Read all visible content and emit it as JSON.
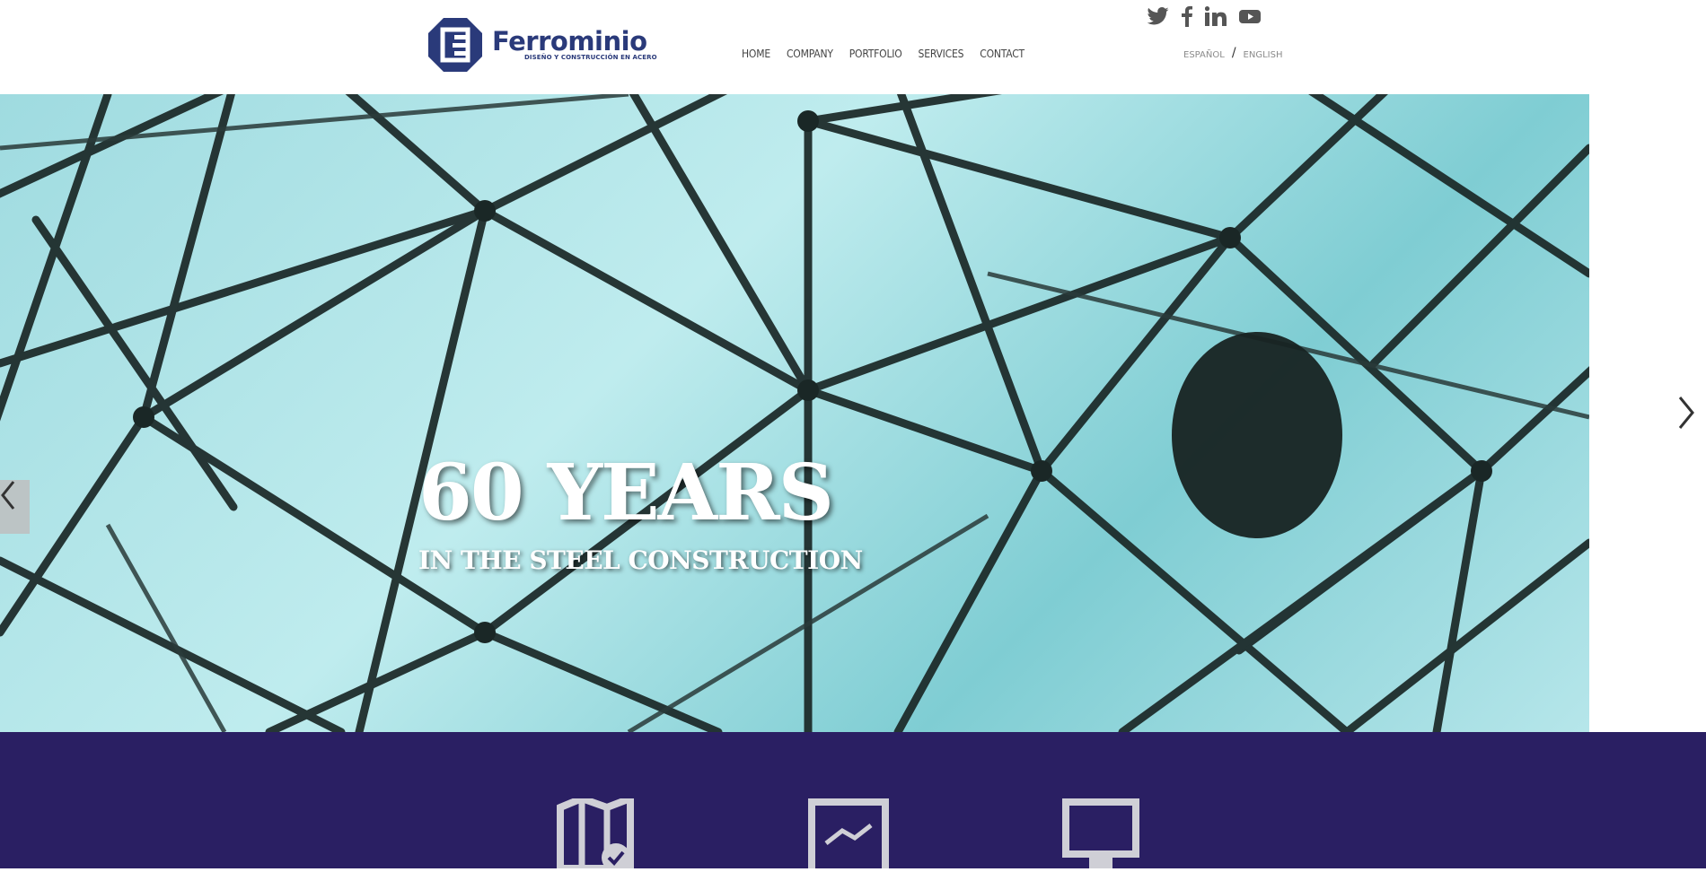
{
  "brand": {
    "name": "Ferrominio",
    "tagline": "DISEÑO Y CONSTRUCCIÓN EN ACERO",
    "color": "#2a3a7a"
  },
  "nav": {
    "items": [
      {
        "label": "HOME"
      },
      {
        "label": "COMPANY"
      },
      {
        "label": "PORTFOLIO"
      },
      {
        "label": "SERVICES"
      },
      {
        "label": "CONTACT"
      }
    ]
  },
  "social": [
    "twitter-icon",
    "facebook-icon",
    "linkedin-icon",
    "youtube-icon"
  ],
  "language": {
    "es": "ESPAÑOL",
    "separator": "/",
    "en": "ENGLISH"
  },
  "hero": {
    "title": "60 YEARS",
    "subtitle": "IN THE STEEL CONSTRUCTION"
  },
  "band": {
    "color": "#2a1f63",
    "icons": [
      "map-check-icon",
      "chart-document-icon",
      "monitor-icon"
    ]
  }
}
